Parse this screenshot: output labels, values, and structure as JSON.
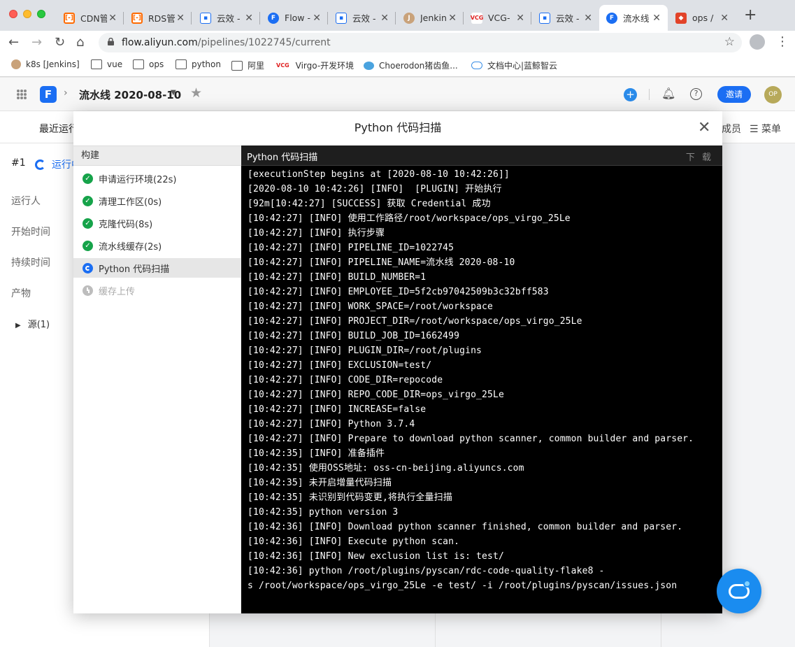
{
  "browser": {
    "tabs": [
      {
        "title": "CDN管",
        "favicon": "aliyun-icon",
        "color": "#ff6a00"
      },
      {
        "title": "RDS管",
        "favicon": "aliyun-icon",
        "color": "#ff6a00"
      },
      {
        "title": "云效 -",
        "favicon": "yunxiao-icon",
        "color": "#1b6ef3"
      },
      {
        "title": "Flow -",
        "favicon": "flow-icon",
        "color": "#1b6ef3"
      },
      {
        "title": "云效 -",
        "favicon": "yunxiao-icon",
        "color": "#1b6ef3"
      },
      {
        "title": "Jenkin",
        "favicon": "jenkins-icon",
        "color": "#c9a27a"
      },
      {
        "title": "VCG-",
        "favicon": "vcg-icon",
        "color": "#e02020"
      },
      {
        "title": "云效 -",
        "favicon": "yunxiao-icon",
        "color": "#1b6ef3"
      },
      {
        "title": "流水线",
        "favicon": "flow-icon",
        "color": "#1b6ef3"
      },
      {
        "title": "ops /",
        "favicon": "gitlab-icon",
        "color": "#e24329"
      }
    ],
    "url_host": "flow.aliyun.com",
    "url_path": "/pipelines/1022745/current",
    "bookmarks": [
      {
        "label": "k8s [Jenkins]"
      },
      {
        "label": "vue"
      },
      {
        "label": "ops"
      },
      {
        "label": "python"
      },
      {
        "label": "阿里"
      },
      {
        "label": "Virgo-开发环境",
        "prefix": "VCG"
      },
      {
        "label": "Choerodon猪齿鱼..."
      },
      {
        "label": "文档中心|蓝鲸智云"
      }
    ]
  },
  "app": {
    "pipeline_name": "流水线 2020-08-10",
    "invite_label": "邀请",
    "avatar_initials": "OP",
    "tab_recent": "最近运行",
    "tab_members": "成员",
    "tab_menu": "☰ 菜单",
    "run_number": "#1",
    "run_status": "运行中",
    "meta": [
      "运行人",
      "开始时间",
      "持续时间",
      "产物"
    ],
    "source_label": "源(1)"
  },
  "modal": {
    "title": "Python 代码扫描",
    "steps_header": "构建",
    "steps": [
      {
        "label": "申请运行环境(22s)",
        "status": "success"
      },
      {
        "label": "清理工作区(0s)",
        "status": "success"
      },
      {
        "label": "克隆代码(8s)",
        "status": "success"
      },
      {
        "label": "流水线缓存(2s)",
        "status": "success"
      },
      {
        "label": "Python 代码扫描",
        "status": "running"
      },
      {
        "label": "缓存上传",
        "status": "pending"
      }
    ],
    "console_title": "Python 代码扫描",
    "download_label": "下 载",
    "log_lines": [
      "[executionStep begins at [2020-08-10 10:42:26]]",
      "[2020-08-10 10:42:26] [INFO]  [PLUGIN] 开始执行",
      "[92m[10:42:27] [SUCCESS] 获取 Credential 成功",
      "[10:42:27] [INFO] 使用工作路径/root/workspace/ops_virgo_25Le",
      "[10:42:27] [INFO] 执行步骤",
      "[10:42:27] [INFO] PIPELINE_ID=1022745",
      "[10:42:27] [INFO] PIPELINE_NAME=流水线 2020-08-10",
      "[10:42:27] [INFO] BUILD_NUMBER=1",
      "[10:42:27] [INFO] EMPLOYEE_ID=5f2cb97042509b3c32bff583",
      "[10:42:27] [INFO] WORK_SPACE=/root/workspace",
      "[10:42:27] [INFO] PROJECT_DIR=/root/workspace/ops_virgo_25Le",
      "[10:42:27] [INFO] BUILD_JOB_ID=1662499",
      "[10:42:27] [INFO] PLUGIN_DIR=/root/plugins",
      "[10:42:27] [INFO] EXCLUSION=test/",
      "[10:42:27] [INFO] CODE_DIR=repocode",
      "[10:42:27] [INFO] REPO_CODE_DIR=ops_virgo_25Le",
      "[10:42:27] [INFO] INCREASE=false",
      "[10:42:27] [INFO] Python 3.7.4",
      "[10:42:27] [INFO] Prepare to download python scanner, common builder and parser.",
      "[10:42:35] [INFO] 准备插件",
      "[10:42:35] 使用OSS地址: oss-cn-beijing.aliyuncs.com",
      "[10:42:35] 未开启增量代码扫描",
      "[10:42:35] 未识别到代码变更,将执行全量扫描",
      "[10:42:35] python version 3",
      "[10:42:36] [INFO] Download python scanner finished, common builder and parser.",
      "[10:42:36] [INFO] Execute python scan.",
      "[10:42:36] [INFO] New exclusion list is: test/",
      "[10:42:36] python /root/plugins/pyscan/rdc-code-quality-flake8 -",
      "s /root/workspace/ops_virgo_25Le -e test/ -i /root/plugins/pyscan/issues.json"
    ]
  }
}
